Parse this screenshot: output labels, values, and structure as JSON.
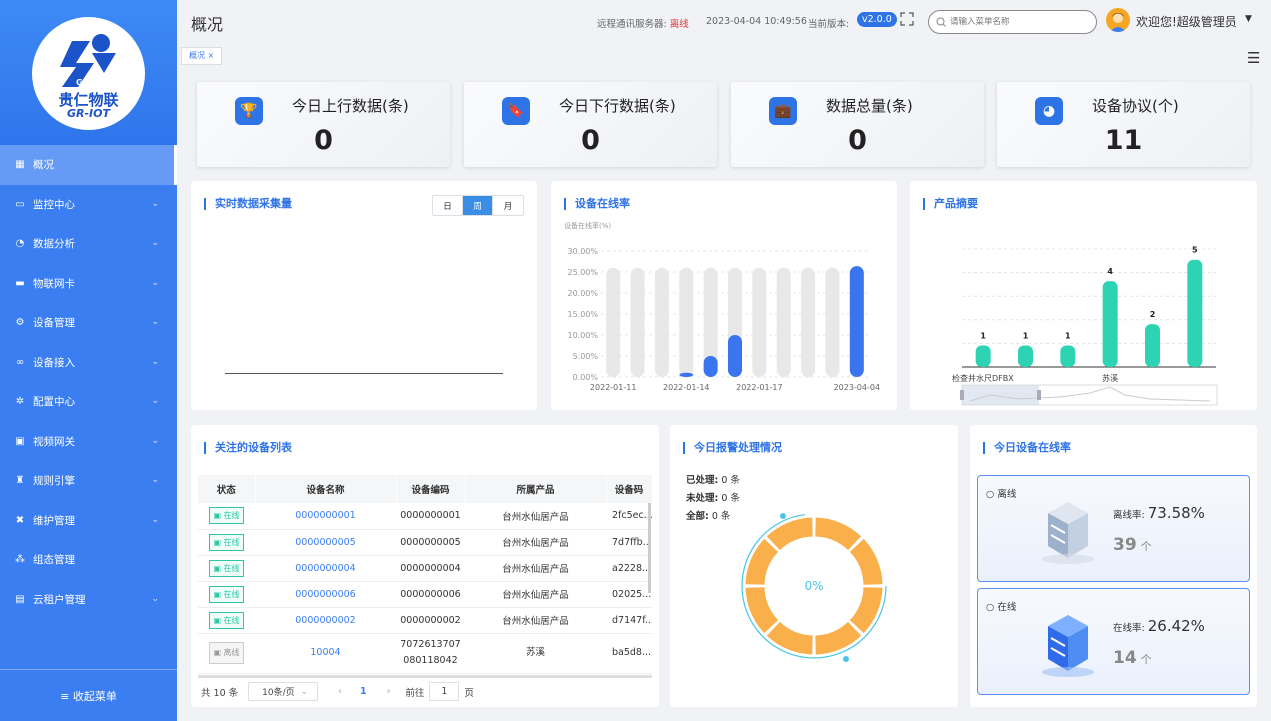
{
  "sidebar": {
    "logo_cn": "贵仁物联",
    "logo_en": "GR-IOT",
    "logo_mark": "GR",
    "items": [
      {
        "label": "概况",
        "icon": "dashboard-icon",
        "glyph": "▦",
        "arrow": false
      },
      {
        "label": "监控中心",
        "icon": "monitor-icon",
        "glyph": "▭",
        "arrow": true
      },
      {
        "label": "数据分析",
        "icon": "analytics-icon",
        "glyph": "◔",
        "arrow": true
      },
      {
        "label": "物联网卡",
        "icon": "sim-card-icon",
        "glyph": "▬",
        "arrow": true
      },
      {
        "label": "设备管理",
        "icon": "device-icon",
        "glyph": "⚙",
        "arrow": true
      },
      {
        "label": "设备接入",
        "icon": "link-icon",
        "glyph": "∞",
        "arrow": true
      },
      {
        "label": "配置中心",
        "icon": "config-icon",
        "glyph": "✲",
        "arrow": true
      },
      {
        "label": "视频网关",
        "icon": "video-icon",
        "glyph": "▣",
        "arrow": true
      },
      {
        "label": "规则引擎",
        "icon": "rule-icon",
        "glyph": "♜",
        "arrow": true
      },
      {
        "label": "维护管理",
        "icon": "wrench-icon",
        "glyph": "✖",
        "arrow": true
      },
      {
        "label": "组态管理",
        "icon": "scada-icon",
        "glyph": "⁂",
        "arrow": false
      },
      {
        "label": "云租户管理",
        "icon": "tenant-icon",
        "glyph": "▤",
        "arrow": true
      }
    ],
    "collapse_label": "≡ 收起菜单"
  },
  "header": {
    "title": "概况",
    "server_label": "远程通讯服务器:",
    "server_status": "离线",
    "datetime": "2023-04-04 10:49:56",
    "version_label": "当前版本:",
    "version": "v2.0.0",
    "search_placeholder": "请输入菜单名称",
    "welcome": "欢迎您!超级管理员",
    "breadcrumb": "概况 ×"
  },
  "stats": [
    {
      "label": "今日上行数据(条)",
      "value": "0",
      "icon": "trophy-icon",
      "glyph": "🏆"
    },
    {
      "label": "今日下行数据(条)",
      "value": "0",
      "icon": "bookmark-icon",
      "glyph": "🔖"
    },
    {
      "label": "数据总量(条)",
      "value": "0",
      "icon": "briefcase-icon",
      "glyph": "💼"
    },
    {
      "label": "设备协议(个)",
      "value": "11",
      "icon": "pie-chart-icon",
      "glyph": "◕"
    }
  ],
  "realtime": {
    "title": "实时数据采集量",
    "tabs": [
      "日",
      "周",
      "月"
    ],
    "active_tab": "周"
  },
  "online_rate": {
    "title": "设备在线率",
    "chart_data": {
      "type": "bar",
      "ylabel": "设备在线率(%)",
      "ylim": [
        0,
        30
      ],
      "yticks": [
        "0.00%",
        "5.00%",
        "10.00%",
        "15.00%",
        "20.00%",
        "25.00%",
        "30.00%"
      ],
      "x_tick_labels": [
        "2022-01-11",
        "2022-01-14",
        "2022-01-17",
        "2023-04-04"
      ],
      "background_value": 26,
      "values": [
        0,
        0,
        0,
        1,
        5,
        10,
        0,
        0,
        0,
        0,
        26.4
      ],
      "color": "#3a74ef",
      "background_color": "#e8e8e8"
    }
  },
  "product_summary": {
    "title": "产品摘要",
    "chart_data": {
      "type": "bar",
      "values": [
        1,
        1,
        1,
        4,
        2,
        5
      ],
      "x_tick_labels": [
        "检查井水尺DFBX",
        "苏溪"
      ],
      "ylim": [
        0,
        5.5
      ],
      "color": "#2ed3b3"
    }
  },
  "device_list": {
    "title": "关注的设备列表",
    "columns": [
      "状态",
      "设备名称",
      "设备编码",
      "所属产品",
      "设备码"
    ],
    "rows": [
      {
        "status": "在线",
        "name": "0000000001",
        "code": "0000000001",
        "product": "台州水仙居产品",
        "dcode": "2fc5ec..."
      },
      {
        "status": "在线",
        "name": "0000000005",
        "code": "0000000005",
        "product": "台州水仙居产品",
        "dcode": "7d7ffb..."
      },
      {
        "status": "在线",
        "name": "0000000004",
        "code": "0000000004",
        "product": "台州水仙居产品",
        "dcode": "a2228..."
      },
      {
        "status": "在线",
        "name": "0000000006",
        "code": "0000000006",
        "product": "台州水仙居产品",
        "dcode": "02025..."
      },
      {
        "status": "在线",
        "name": "0000000002",
        "code": "0000000002",
        "product": "台州水仙居产品",
        "dcode": "d7147f..."
      },
      {
        "status": "离线",
        "name": "10004",
        "code": "7072613707 080118042",
        "product": "苏溪",
        "dcode": "ba5d8..."
      }
    ],
    "pager": {
      "total": "共 10 条",
      "page_size": "10条/页",
      "current": "1",
      "goto_label": "前往",
      "goto_value": "1",
      "page_suffix": "页"
    }
  },
  "alarm": {
    "title": "今日报警处理情况",
    "lines": [
      {
        "label": "已处理:",
        "value": "0 条"
      },
      {
        "label": "未处理:",
        "value": "0 条"
      },
      {
        "label": "全部:",
        "value": "0 条"
      }
    ],
    "percent": "0%",
    "ring_color": "#f9b04a"
  },
  "today_online": {
    "title": "今日设备在线率",
    "cards": [
      {
        "title": "离线",
        "rate_label": "离线率:",
        "rate": "73.58%",
        "count": "39",
        "unit": "个"
      },
      {
        "title": "在线",
        "rate_label": "在线率:",
        "rate": "26.42%",
        "count": "14",
        "unit": "个"
      }
    ]
  }
}
